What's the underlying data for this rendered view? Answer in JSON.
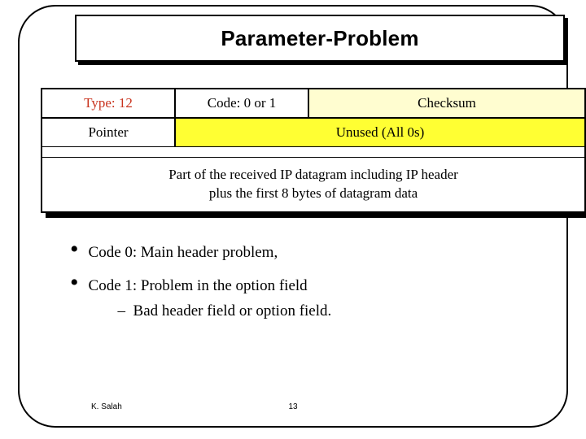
{
  "title": "Parameter-Problem",
  "packet": {
    "type": "Type: 12",
    "code": "Code: 0 or 1",
    "checksum": "Checksum",
    "pointer": "Pointer",
    "unused": "Unused (All 0s)",
    "desc_line1": "Part of the received IP datagram including IP header",
    "desc_line2": "plus the first 8 bytes of datagram data"
  },
  "bullets": {
    "b0": "Code 0:  Main header problem,",
    "b1": "Code 1:  Problem in the option field",
    "b1_sub": "Bad header field or option field."
  },
  "footer": {
    "author": "K. Salah",
    "page": "13"
  }
}
